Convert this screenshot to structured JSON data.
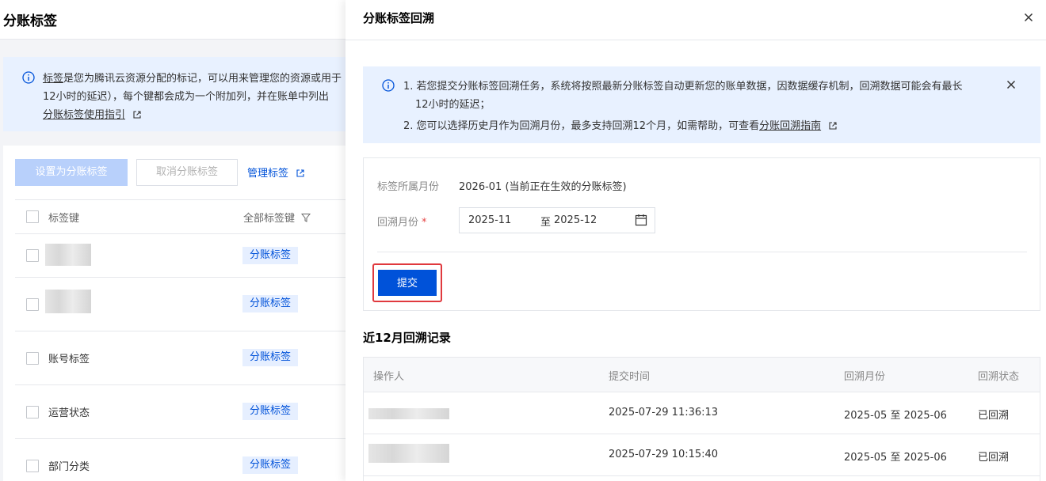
{
  "page": {
    "title": "分账标签",
    "notice": {
      "line1_link": "标签",
      "line1_rest": "是您为腾讯云资源分配的标记，可以用来管理您的资源或用于",
      "line2": "12小时的延迟），每个键都会成为一个附加列，并在账单中列出",
      "guide_link": "分账标签使用指引"
    },
    "toolbar": {
      "set_label": "设置为分账标签",
      "cancel_label": "取消分账标签",
      "manage_label": "管理标签"
    },
    "table": {
      "col_key": "标签键",
      "col_all": "全部标签键",
      "rows": [
        {
          "key": "",
          "tag": "分账标签"
        },
        {
          "key": "",
          "tag": "分账标签"
        },
        {
          "key": "账号标签",
          "tag": "分账标签"
        },
        {
          "key": "运营状态",
          "tag": "分账标签"
        },
        {
          "key": "部门分类",
          "tag": "分账标签"
        }
      ]
    }
  },
  "dialog": {
    "title": "分账标签回溯",
    "alert": {
      "line1": "1. 若您提交分账标签回溯任务，系统将按照最新分账标签自动更新您的账单数据，因数据缓存机制，回溯数据可能会有最长",
      "line1b": "12小时的延迟；",
      "line2_prefix": "2. 您可以选择历史月作为回溯月份，最多支持回溯12个月，如需帮助，可查看",
      "line2_link": "分账回溯指南"
    },
    "form": {
      "month_label": "标签所属月份",
      "month_value": "2026-01 (当前正在生效的分账标签)",
      "range_label": "回溯月份",
      "required_mark": "*",
      "range_start": "2025-11",
      "range_sep": "至",
      "range_end": "2025-12",
      "submit_label": "提交"
    },
    "records": {
      "title": "近12月回溯记录",
      "columns": [
        "操作人",
        "提交时间",
        "回溯月份",
        "回溯状态"
      ],
      "rows": [
        {
          "operator": "",
          "time": "2025-07-29 11:36:13",
          "months": "2025-05 至 2025-06",
          "status": "已回溯"
        },
        {
          "operator": "",
          "time": "2025-07-29 10:15:40",
          "months": "2025-05 至 2025-06",
          "status": "已回溯"
        }
      ]
    }
  },
  "colors": {
    "primary": "#0052d9",
    "alert_bg": "#e8f1ff",
    "highlight_border": "#e0393e",
    "tag_bg": "#e6efff"
  },
  "icons": [
    "info-icon",
    "close-icon",
    "external-link-icon",
    "calendar-icon",
    "filter-icon"
  ]
}
